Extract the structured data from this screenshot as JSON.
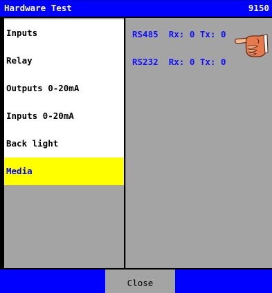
{
  "window": {
    "title": "Hardware Test",
    "code": "9150"
  },
  "menu": {
    "items": [
      {
        "label": "Inputs"
      },
      {
        "label": "Relay"
      },
      {
        "label": "Outputs 0-20mA"
      },
      {
        "label": "Inputs 0-20mA"
      },
      {
        "label": "Back light"
      },
      {
        "label": "Media"
      }
    ],
    "selected": "Media"
  },
  "ports": [
    {
      "name": "RS485",
      "rx_label": "Rx:",
      "rx": "0",
      "tx_label": "Tx:",
      "tx": "0"
    },
    {
      "name": "RS232",
      "rx_label": "Rx:",
      "rx": "0",
      "tx_label": "Tx:",
      "tx": "0"
    }
  ],
  "pointer_icon": "pointing-hand-icon",
  "footer": {
    "close_label": "Close"
  },
  "colors": {
    "title_bar": "#0000ff",
    "selected_item": "#ffff00",
    "panel": "#a4a4a4",
    "port_text": "#1010ff"
  }
}
